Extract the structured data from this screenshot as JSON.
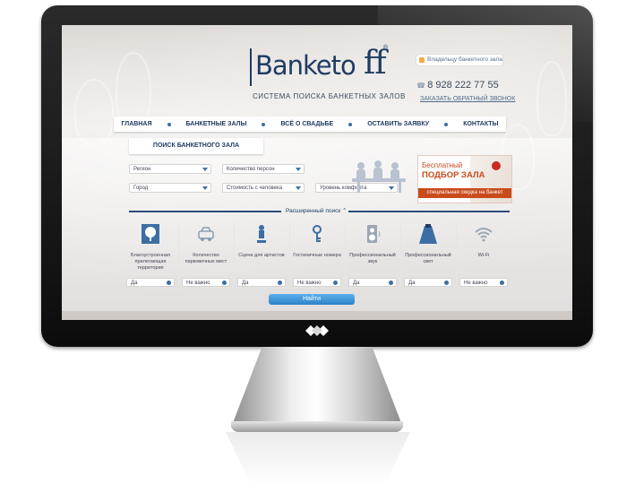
{
  "logo": {
    "text": "Banketo",
    "tagline": "СИСТЕМА ПОИСКА БАНКЕТНЫХ ЗАЛОВ"
  },
  "header": {
    "owner_button": "Владельцу банкетного зала",
    "phone": "8 928 222 77 55",
    "callback": "ЗАКАЗАТЬ ОБРАТНЫЙ ЗВОНОК"
  },
  "nav": {
    "items": [
      {
        "label": "ГЛАВНАЯ"
      },
      {
        "label": "БАНКЕТНЫЕ ЗАЛЫ"
      },
      {
        "label": "ВСЁ О СВАДЬБЕ"
      },
      {
        "label": "ОСТАВИТЬ ЗАЯВКУ"
      },
      {
        "label": "КОНТАКТЫ"
      }
    ]
  },
  "search": {
    "tab_label": "ПОИСК БАНКЕТНОГО ЗАЛА",
    "selects": {
      "region": "Регион",
      "guests": "Количество персон",
      "city": "Город",
      "price": "Стоимость с человека",
      "comfort": "Уровень комфорта"
    },
    "extended_label": "Расширенный поиск",
    "find_button": "Найти"
  },
  "promo": {
    "line1": "Бесплатный",
    "line2": "ПОДБОР ЗАЛА",
    "line3": "специальная скидка на банкет"
  },
  "amenities": [
    {
      "label": "Благоустроенная прилегающая территория",
      "value": "Да",
      "icon": "tree-icon"
    },
    {
      "label": "Количество парковочных мест",
      "value": "Не важно",
      "icon": "car-icon"
    },
    {
      "label": "Сцена для артистов",
      "value": "Да",
      "icon": "singer-icon"
    },
    {
      "label": "Гостиничные номера",
      "value": "Не важно",
      "icon": "key-icon"
    },
    {
      "label": "Профессиональный звук",
      "value": "Да",
      "icon": "speaker-icon"
    },
    {
      "label": "Профессиональный свет",
      "value": "Да",
      "icon": "spotlight-icon"
    },
    {
      "label": "Wi-Fi",
      "value": "Не важно",
      "icon": "wifi-icon"
    }
  ],
  "colors": {
    "brand": "#1f3b63",
    "accent": "#3d6ea3",
    "promo": "#c94b1c",
    "button": "#2e82c6"
  }
}
